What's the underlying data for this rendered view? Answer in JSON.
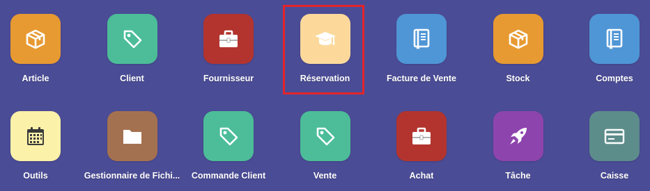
{
  "apps": [
    {
      "label": "Article",
      "color": "#e79a31",
      "icon": "box-icon"
    },
    {
      "label": "Client",
      "color": "#4cbd98",
      "icon": "tag-icon"
    },
    {
      "label": "Fournisseur",
      "color": "#b3342e",
      "icon": "briefcase-icon"
    },
    {
      "label": "Réservation",
      "color": "#fcd99b",
      "icon": "graduation-cap-icon"
    },
    {
      "label": "Facture de Vente",
      "color": "#4f96d6",
      "icon": "book-icon"
    },
    {
      "label": "Stock",
      "color": "#e79a31",
      "icon": "box-icon"
    },
    {
      "label": "Comptes",
      "color": "#4f96d6",
      "icon": "book-icon"
    },
    {
      "label": "Outils",
      "color": "#fbf1a9",
      "icon": "calendar-icon"
    },
    {
      "label": "Gestionnaire de Fichi...",
      "color": "#a47150",
      "icon": "folder-icon"
    },
    {
      "label": "Commande Client",
      "color": "#4cbd98",
      "icon": "tag-icon"
    },
    {
      "label": "Vente",
      "color": "#4cbd98",
      "icon": "tag-icon"
    },
    {
      "label": "Achat",
      "color": "#b3342e",
      "icon": "briefcase-icon"
    },
    {
      "label": "Tâche",
      "color": "#8d44ad",
      "icon": "rocket-icon"
    },
    {
      "label": "Caisse",
      "color": "#5d8d8b",
      "icon": "credit-card-icon"
    }
  ],
  "highlighted_app": "Réservation",
  "highlight_color": "#e3242b"
}
